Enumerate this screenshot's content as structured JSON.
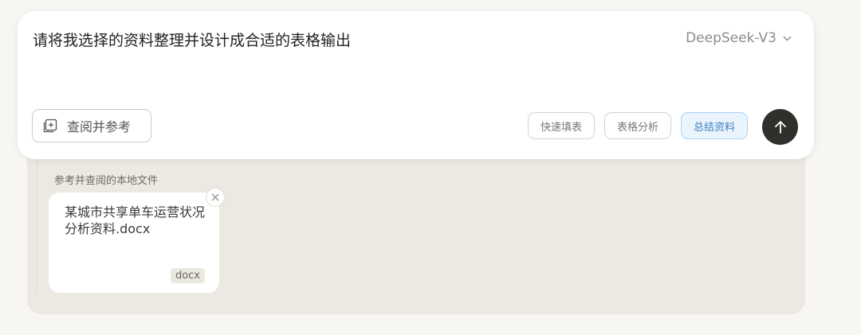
{
  "composer": {
    "prompt": "请将我选择的资料整理并设计成合适的表格输出",
    "model_selector": {
      "label": "DeepSeek-V3",
      "icon": "chevron-down-icon"
    },
    "reference_button": {
      "label": "查阅并参考",
      "icon": "add-document-icon"
    },
    "quick_actions": [
      {
        "label": "快速填表",
        "active": false
      },
      {
        "label": "表格分析",
        "active": false
      },
      {
        "label": "总结资料",
        "active": true
      }
    ],
    "send_button": {
      "icon": "arrow-up-icon"
    }
  },
  "references": {
    "title": "参考并查阅的本地文件",
    "files": [
      {
        "name": "某城市共享单车运营状况分析资料.docx",
        "type": "docx",
        "remove_icon": "close-icon"
      }
    ]
  },
  "colors": {
    "page_bg": "#f7f6f2",
    "panel_bg": "#ece9e2",
    "send_bg": "#2f2f2c",
    "accent_blue": "#3d7fc1"
  }
}
